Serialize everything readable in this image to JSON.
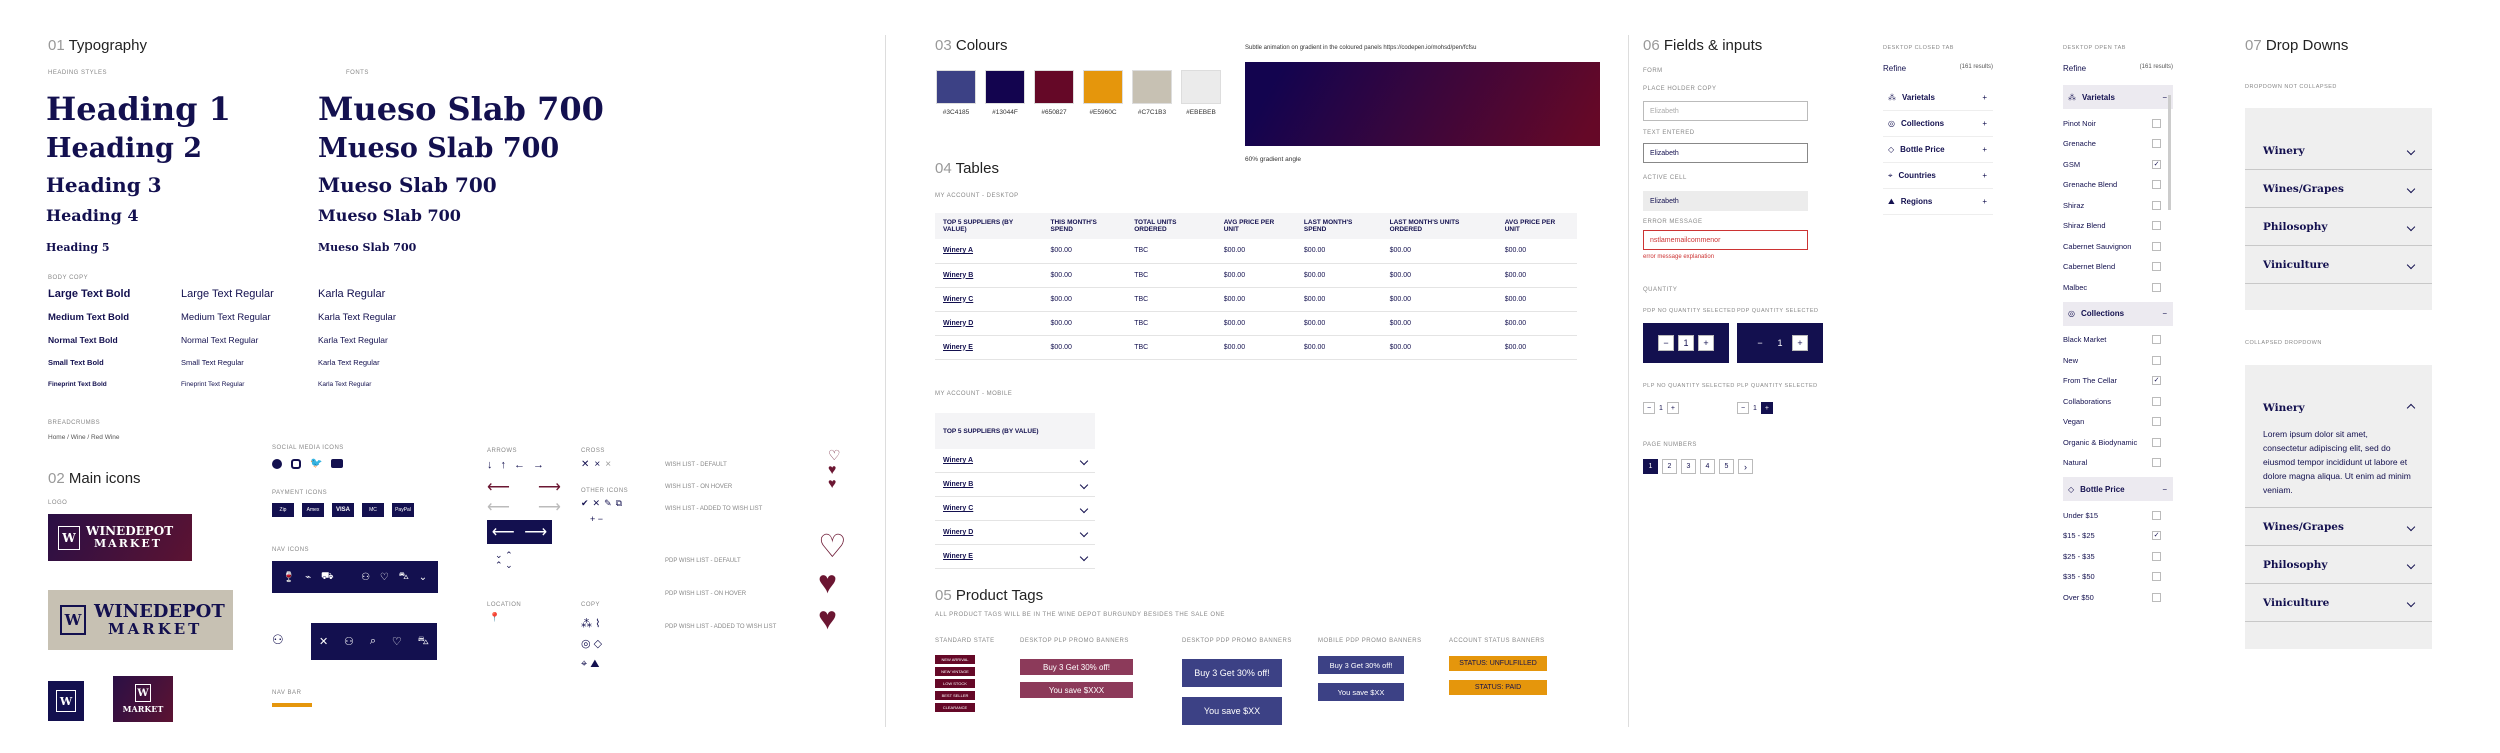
{
  "typography": {
    "num": "01",
    "title": "Typography",
    "heading_styles_label": "HEADING STYLES",
    "fonts_label": "FONTS",
    "headings": [
      "Heading 1",
      "Heading 2",
      "Heading 3",
      "Heading 4",
      "Heading 5"
    ],
    "fonts": [
      "Mueso Slab 700",
      "Mueso Slab 700",
      "Mueso Slab 700",
      "Mueso Slab 700",
      "Mueso Slab 700"
    ],
    "body_copy_label": "BODY COPY",
    "body_bold": [
      "Large Text Bold",
      "Medium Text Bold",
      "Normal Text Bold",
      "Small Text Bold",
      "Fineprint Text Bold"
    ],
    "body_regular": [
      "Large Text Regular",
      "Medium Text Regular",
      "Normal Text Regular",
      "Small Text Regular",
      "Fineprint Text Regular"
    ],
    "karla": [
      "Karla Regular",
      "Karla Text Regular",
      "Karla Text Regular",
      "Karla Text Regular",
      "Karla Text Regular"
    ],
    "breadcrumbs_label": "BREADCRUMBS",
    "breadcrumb": "Home / Wine / Red Wine"
  },
  "icons": {
    "num": "02",
    "title": "Main icons",
    "logo_label": "LOGO",
    "logo_line1": "WINEDEPOT",
    "logo_line2": "MARKET",
    "social_label": "SOCIAL MEDIA ICONS",
    "payment_label": "PAYMENT ICONS",
    "payment": [
      "Zip",
      "Amex",
      "VISA",
      "MC",
      "PayPal"
    ],
    "nav_label": "NAV ICONS",
    "nav_bar_label": "NAV BAR",
    "arrows_label": "ARROWS",
    "cross_label": "CROSS",
    "other_label": "OTHER ICONS",
    "location_label": "LOCATION",
    "copy_label": "COPY",
    "wish_states": [
      "WISH LIST - DEFAULT",
      "WISH LIST - ON HOVER",
      "WISH LIST - ADDED TO WISH LIST"
    ],
    "pdp_wish_states": [
      "PDP WISH LIST - DEFAULT",
      "PDP WISH LIST - ON HOVER",
      "PDP WISH LIST - ADDED TO WISH LIST"
    ]
  },
  "colours": {
    "num": "03",
    "title": "Colours",
    "swatches": [
      {
        "hex": "#3C4185",
        "label": "#3C4185"
      },
      {
        "hex": "#13044F",
        "label": "#13044F"
      },
      {
        "hex": "#650827",
        "label": "#650827"
      },
      {
        "hex": "#E5960C",
        "label": "#E5960C"
      },
      {
        "hex": "#C7C1B3",
        "label": "#C7C1B3"
      },
      {
        "hex": "#EBEBEB",
        "label": "#EBEBEB"
      }
    ],
    "gradient_note": "Subtle animation on gradient in the coloured panels https://codepen.io/mohsd/pen/fcfsu",
    "gradient_caption": "60% gradient angle"
  },
  "tables": {
    "num": "04",
    "title": "Tables",
    "desktop_label": "MY ACCOUNT - DESKTOP",
    "headers": [
      "TOP 5 SUPPLIERS (BY VALUE)",
      "THIS MONTH'S SPEND",
      "TOTAL UNITS ORDERED",
      "AVG PRICE PER UNIT",
      "LAST MONTH'S SPEND",
      "LAST MONTH'S UNITS ORDERED",
      "AVG PRICE PER UNIT"
    ],
    "rows": [
      [
        "Winery A",
        "$00.00",
        "TBC",
        "$00.00",
        "$00.00",
        "$00.00",
        "$00.00"
      ],
      [
        "Winery B",
        "$00.00",
        "TBC",
        "$00.00",
        "$00.00",
        "$00.00",
        "$00.00"
      ],
      [
        "Winery C",
        "$00.00",
        "TBC",
        "$00.00",
        "$00.00",
        "$00.00",
        "$00.00"
      ],
      [
        "Winery D",
        "$00.00",
        "TBC",
        "$00.00",
        "$00.00",
        "$00.00",
        "$00.00"
      ],
      [
        "Winery E",
        "$00.00",
        "TBC",
        "$00.00",
        "$00.00",
        "$00.00",
        "$00.00"
      ]
    ],
    "mobile_label": "MY ACCOUNT - MOBILE",
    "mobile_header": "TOP 5 SUPPLIERS (BY VALUE)",
    "mobile_rows": [
      "Winery A",
      "Winery B",
      "Winery C",
      "Winery D",
      "Winery E"
    ]
  },
  "tags": {
    "num": "05",
    "title": "Product Tags",
    "note": "ALL PRODUCT TAGS WILL BE IN THE WINE DEPOT BURGUNDY BESIDES THE SALE ONE",
    "standard_label": "STANDARD STATE",
    "standard": [
      "NEW ARRIVAL",
      "NEW VINTAGE",
      "LOW STOCK",
      "BEST SELLER",
      "CLEARANCE"
    ],
    "plp_label": "DESKTOP PLP PROMO BANNERS",
    "plp": [
      "Buy 3 Get 30% off!",
      "You save $XXX"
    ],
    "pdp_label": "DESKTOP PDP PROMO BANNERS",
    "pdp": [
      "Buy 3 Get 30% off!",
      "You save $XX"
    ],
    "mobile_label": "MOBILE PDP PROMO BANNERS",
    "mobile": [
      "Buy 3 Get 30% off!",
      "You save $XX"
    ],
    "status_label": "ACCOUNT STATUS BANNERS",
    "status": [
      "STATUS: UNFULFILLED",
      "STATUS: PAID"
    ]
  },
  "fields": {
    "num": "06",
    "title": "Fields & inputs",
    "form_label": "FORM",
    "placeholder_label": "PLACE HOLDER COPY",
    "placeholder": "Elizabeth",
    "entered_label": "TEXT ENTERED",
    "entered": "Elizabeth",
    "active_label": "ACTIVE CELL",
    "active": "Elizabeth",
    "error_label": "ERROR MESSAGE",
    "error_value": "nstlamemailcommenor",
    "error_msg": "error message explanation",
    "quantity_label": "QUANTITY",
    "pdp_qty_label": "PDP NO QUANTITY SELECTED",
    "pdp_qty_sel_label": "PDP QUANTITY SELECTED",
    "plp_qty_label": "PLP NO QUANTITY SELECTED",
    "plp_qty_sel_label": "PLP QUANTITY SELECTED",
    "qty_value": "1",
    "page_label": "PAGE NUMBERS",
    "pages": [
      "1",
      "2",
      "3",
      "4",
      "5"
    ]
  },
  "filters": {
    "closed_label": "DESKTOP CLOSED TAB",
    "open_label": "DESKTOP OPEN TAB",
    "refine": "Refine",
    "results": "(161 results)",
    "closed_items": [
      "Varietals",
      "Collections",
      "Bottle Price",
      "Countries",
      "Regions"
    ],
    "varietals_title": "Varietals",
    "varietals": [
      "Pinot Noir",
      "Grenache",
      "GSM",
      "Grenache Blend",
      "Shiraz",
      "Shiraz Blend",
      "Cabernet Sauvignon",
      "Cabernet Blend",
      "Malbec"
    ],
    "collections_title": "Collections",
    "collections": [
      "Black Market",
      "New",
      "From The Cellar",
      "Collaborations",
      "Vegan",
      "Organic & Biodynamic",
      "Natural"
    ],
    "price_title": "Bottle Price",
    "prices": [
      "Under $15",
      "$15 - $25",
      "$25 - $35",
      "$35 - $50",
      "Over $50"
    ]
  },
  "dropdowns": {
    "num": "07",
    "title": "Drop Downs",
    "not_collapsed_label": "DROPDOWN NOT COLLAPSED",
    "items": [
      "Winery",
      "Wines/Grapes",
      "Philosophy",
      "Viniculture"
    ],
    "collapsed_label": "COLLAPSED DROPDOWN",
    "open_title": "Winery",
    "open_body": "Lorem ipsum dolor sit amet, consectetur adipiscing elit, sed do eiusmod tempor incididunt ut labore et dolore magna aliqua. Ut enim ad minim veniam.",
    "items2": [
      "Wines/Grapes",
      "Philosophy",
      "Viniculture"
    ]
  },
  "colors": {
    "navy": "#13104F",
    "burgundy": "#6B1632",
    "gold": "#E5960C",
    "beige": "#C7C1B3"
  }
}
